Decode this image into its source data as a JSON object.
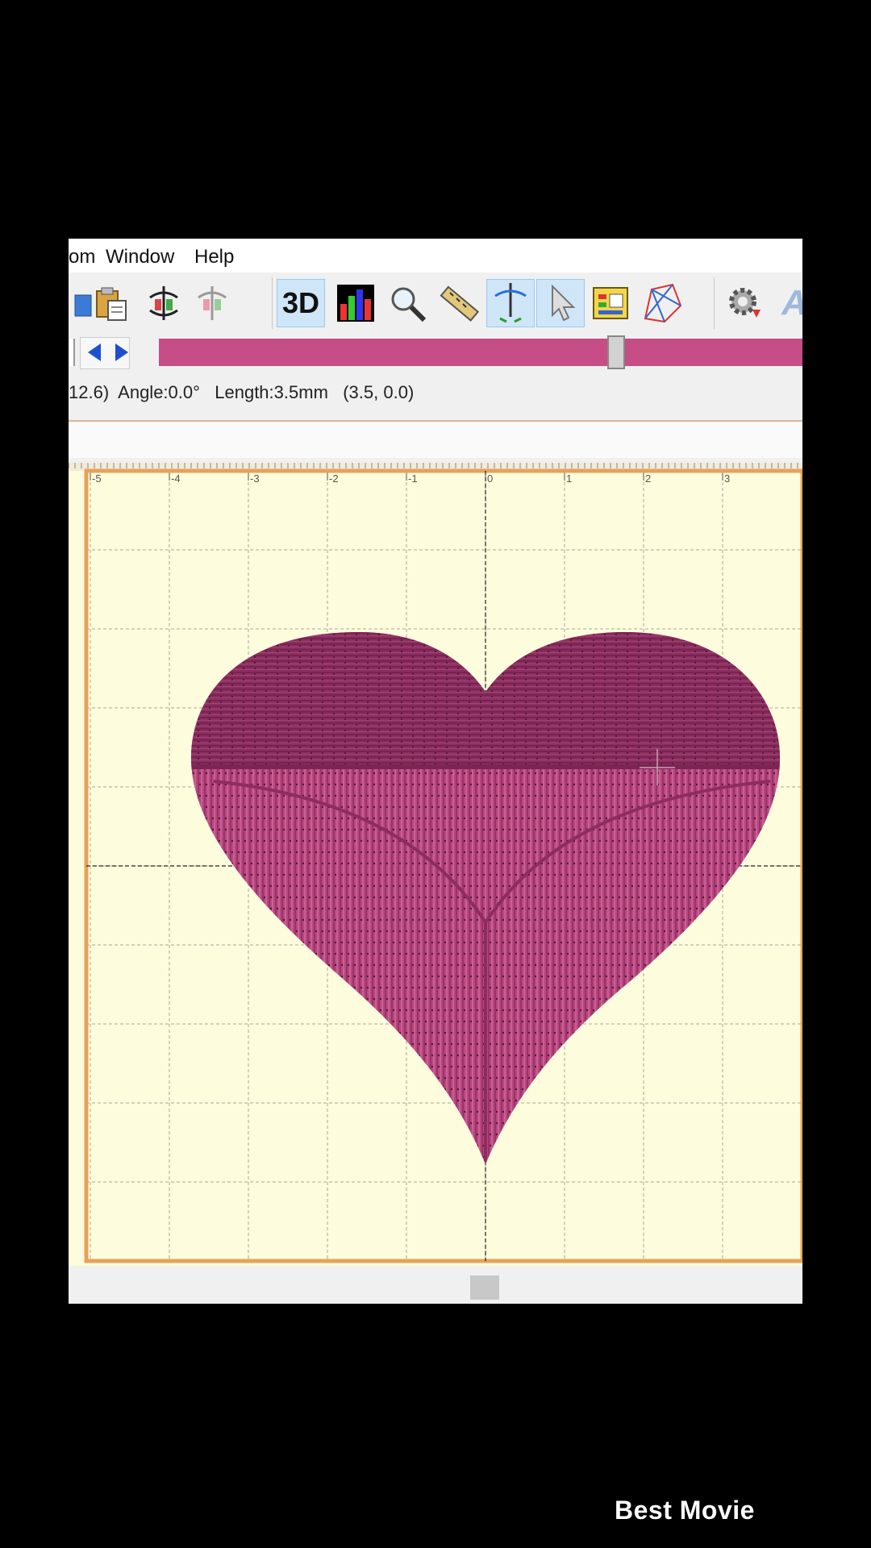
{
  "menu": {
    "partial_item": "om",
    "window": "Window",
    "help": "Help"
  },
  "toolbar": {
    "three_d_label": "3D",
    "icons": [
      "open-partial-icon",
      "paste-icon",
      "flip-icon",
      "mirror-icon",
      "3d-view-icon",
      "color-chart-icon",
      "zoom-icon",
      "measure-ruler-icon",
      "needle-stitch-icon",
      "select-pointer-icon",
      "color-palette-icon",
      "wireframe-icon",
      "settings-gear-icon",
      "text-tool-icon"
    ]
  },
  "sequence": {
    "slider_position": 0.71,
    "bar_color": "#c74d86"
  },
  "status": {
    "text": "12.6)  Angle:0.0°   Length:3.5mm   (3.5, 0.0)"
  },
  "canvas": {
    "ruler_labels": [
      "-5",
      "-4",
      "-3",
      "-2",
      "-1",
      "0",
      "1",
      "2",
      "3"
    ],
    "background_color": "#fdfcdc",
    "hoop_color": "#e6a25a",
    "fill_top_color": "#8c2f60",
    "fill_bottom_color": "#b8467f"
  },
  "watermark": {
    "text": "Best Movie"
  }
}
